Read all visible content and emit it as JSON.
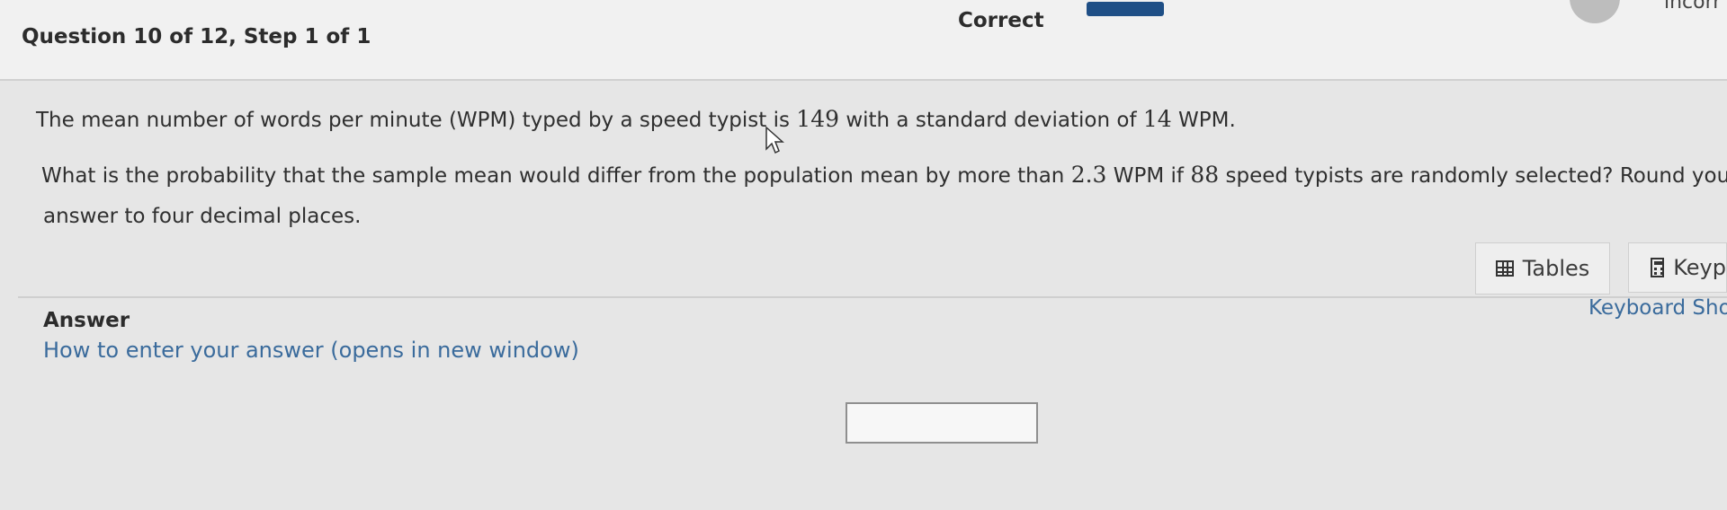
{
  "header": {
    "question_label": "Question 10 of 12,  Step 1 of 1",
    "status": "Correct",
    "partial_text": "incorr"
  },
  "problem": {
    "line1_a": "The mean number of words per minute (WPM) typed by a speed typist is ",
    "mean": "149",
    "line1_b": " with a standard deviation of ",
    "sd": "14",
    "line1_c": " WPM.",
    "line2_a": "What is the probability that the sample mean would differ from the population mean by more than ",
    "diff": "2.3",
    "line2_b": " WPM if ",
    "n": "88",
    "line2_c": " speed typists are randomly selected? Round your",
    "line3": "answer to four decimal places."
  },
  "tools": {
    "tables_label": "Tables",
    "keypad_label": "Keyp",
    "keyboard_shortcuts_label": "Keyboard Shor"
  },
  "answer": {
    "heading": "Answer",
    "how_to_link": "How to enter your answer (opens in new window)",
    "value": ""
  },
  "icons": [
    "table-icon",
    "calculator-icon",
    "mouse-cursor-icon"
  ],
  "colors": {
    "link": "#3a6b9c",
    "progress": "#1f4f86"
  }
}
